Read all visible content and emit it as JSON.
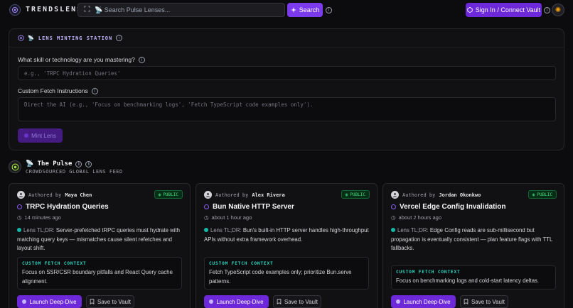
{
  "header": {
    "brand": "TRENDSLENS",
    "search_placeholder": "📡 Search Pulse Lenses...",
    "search_button": "Search",
    "signin_button": "Sign In / Connect Vault"
  },
  "mint": {
    "title": "📡 LENS MINTING STATION",
    "skill_label": "What skill or technology are you mastering?",
    "skill_placeholder": "e.g., 'TRPC Hydration Queries'",
    "fetch_label": "Custom Fetch Instructions",
    "fetch_placeholder": "Direct the AI (e.g., 'Focus on benchmarking logs', 'Fetch TypeScript code examples only').",
    "mint_button": "Mint Lens"
  },
  "pulse": {
    "title": "📡 The Pulse",
    "subtitle": "CROWDSOURCED GLOBAL LENS FEED"
  },
  "cards": [
    {
      "authored_by": "Authored by",
      "author": "Maya Chen",
      "badge": "PUBLIC",
      "title": "TRPC Hydration Queries",
      "time": "14 minutes ago",
      "tldr_label": "Lens TL;DR:",
      "tldr": "Server-prefetched tRPC queries must hydrate with matching query keys — mismatches cause silent refetches and layout shift.",
      "context_heading": "CUSTOM FETCH CONTEXT",
      "context": "Focus on SSR/CSR boundary pitfalls and React Query cache alignment.",
      "launch": "Launch Deep-Dive",
      "save": "Save to Vault"
    },
    {
      "authored_by": "Authored by",
      "author": "Alex Rivera",
      "badge": "PUBLIC",
      "title": "Bun Native HTTP Server",
      "time": "about 1 hour ago",
      "tldr_label": "Lens TL;DR:",
      "tldr": "Bun's built-in HTTP server handles high-throughput APIs without extra framework overhead.",
      "context_heading": "CUSTOM FETCH CONTEXT",
      "context": "Fetch TypeScript code examples only; prioritize Bun.serve patterns.",
      "launch": "Launch Deep-Dive",
      "save": "Save to Vault"
    },
    {
      "authored_by": "Authored by",
      "author": "Jordan Okonkwo",
      "badge": "PUBLIC",
      "title": "Vercel Edge Config Invalidation",
      "time": "about 2 hours ago",
      "tldr_label": "Lens TL;DR:",
      "tldr": "Edge Config reads are sub-millisecond but propagation is eventually consistent — plan feature flags with TTL fallbacks.",
      "context_heading": "CUSTOM FETCH CONTEXT",
      "context": "Focus on benchmarking logs and cold-start latency deltas.",
      "launch": "Launch Deep-Dive",
      "save": "Save to Vault"
    }
  ],
  "colors": {
    "accent": "#7c3aed",
    "background": "#0c0c0f",
    "panel": "#111114",
    "public_badge": "#4ade80",
    "context_heading": "#2dd4bf"
  }
}
